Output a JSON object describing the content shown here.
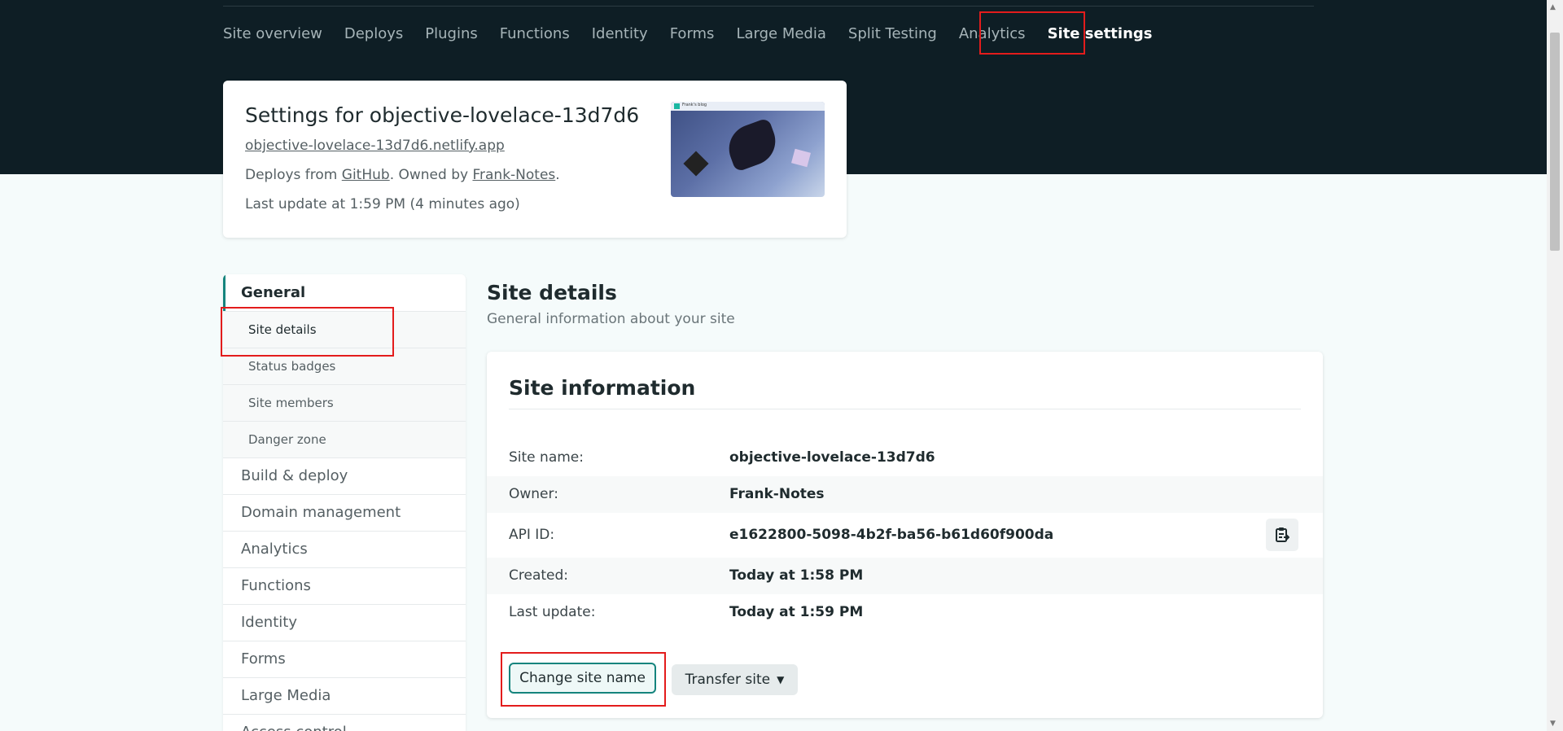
{
  "nav": {
    "items": [
      "Site overview",
      "Deploys",
      "Plugins",
      "Functions",
      "Identity",
      "Forms",
      "Large Media",
      "Split Testing",
      "Analytics"
    ],
    "active": "Site settings"
  },
  "site_card": {
    "title": "Settings for objective-lovelace-13d7d6",
    "url": "objective-lovelace-13d7d6.netlify.app",
    "deploy_prefix": "Deploys from ",
    "deploy_source": "GitHub",
    "owned_prefix": ". Owned by ",
    "owner": "Frank-Notes",
    "owned_suffix": ".",
    "last_update": "Last update at 1:59 PM (4 minutes ago)",
    "thumb_label": "Frank's blog"
  },
  "sidebar": {
    "heading": "General",
    "sub_items": [
      "Site details",
      "Status badges",
      "Site members",
      "Danger zone"
    ],
    "main_items": [
      "Build & deploy",
      "Domain management",
      "Analytics",
      "Functions",
      "Identity",
      "Forms",
      "Large Media",
      "Access control"
    ]
  },
  "section": {
    "title": "Site details",
    "subtitle": "General information about your site"
  },
  "info": {
    "title": "Site information",
    "rows": [
      {
        "label": "Site name:",
        "value": "objective-lovelace-13d7d6"
      },
      {
        "label": "Owner:",
        "value": "Frank-Notes"
      },
      {
        "label": "API ID:",
        "value": "e1622800-5098-4b2f-ba56-b61d60f900da"
      },
      {
        "label": "Created:",
        "value": "Today at 1:58 PM"
      },
      {
        "label": "Last update:",
        "value": "Today at 1:59 PM"
      }
    ],
    "change_name_label": "Change site name",
    "transfer_label": "Transfer site"
  },
  "colors": {
    "header_bg": "#0e1e25",
    "accent": "#15847d",
    "highlight": "#e31c1c"
  }
}
